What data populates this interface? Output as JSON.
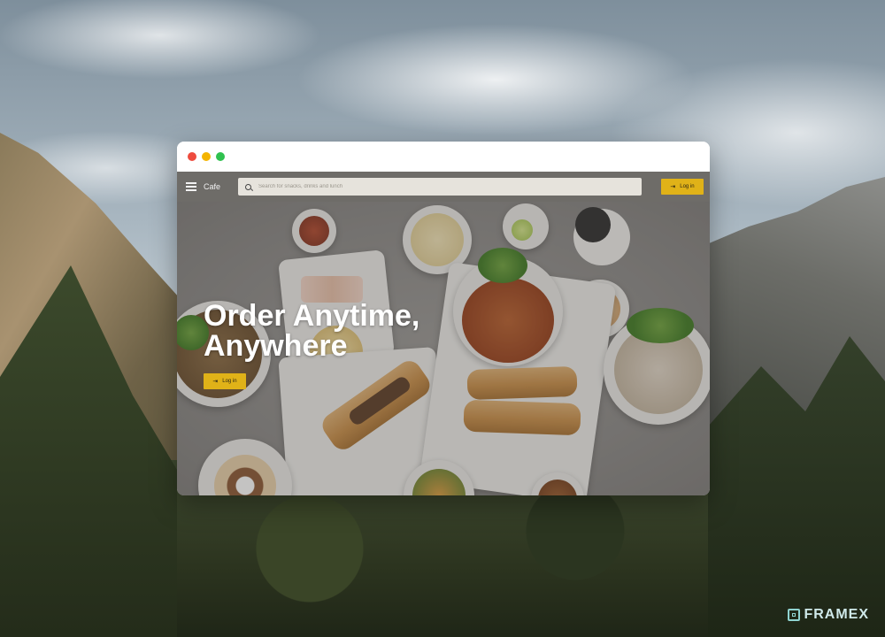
{
  "window": {
    "traffic_lights": [
      "close",
      "minimize",
      "maximize"
    ]
  },
  "appbar": {
    "menu_icon": "hamburger-menu-icon",
    "app_name": "Cafe",
    "search": {
      "icon": "search-icon",
      "placeholder": "Search for snacks, drinks and lunch",
      "value": ""
    },
    "login_label": "Log in",
    "login_icon": "login-arrow-icon"
  },
  "hero": {
    "title_line1": "Order Anytime,",
    "title_line2": "Anywhere",
    "login_label": "Log in",
    "login_icon": "login-arrow-icon"
  },
  "brand": {
    "name": "FRAMEX"
  },
  "colors": {
    "accent": "#e0b218",
    "appbar": "#6e6c68",
    "search_bg": "#e6e3dc",
    "close": "#ee4b3e",
    "minimize": "#f4b400",
    "maximize": "#2fc14f"
  }
}
